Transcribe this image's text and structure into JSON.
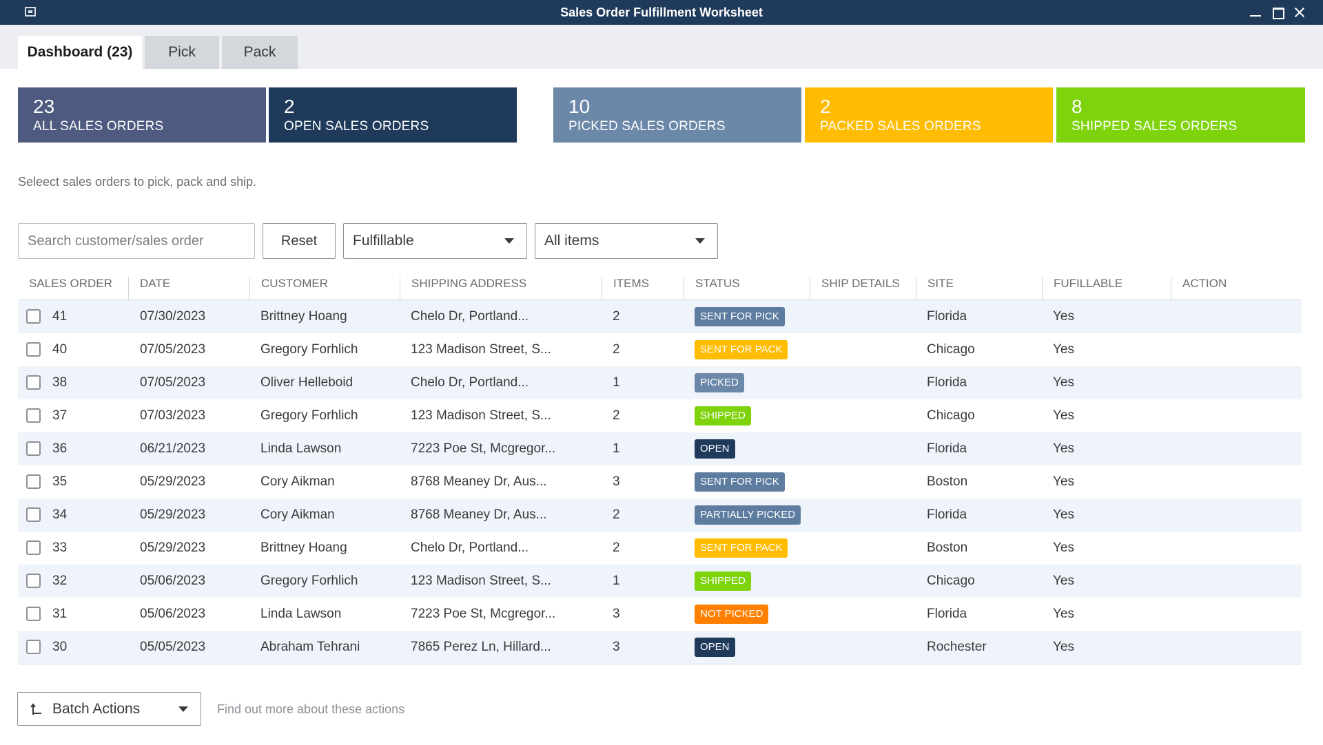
{
  "window": {
    "title": "Sales Order Fulfillment Worksheet"
  },
  "tabs": [
    {
      "label": "Dashboard (23)"
    },
    {
      "label": "Pick"
    },
    {
      "label": "Pack"
    }
  ],
  "cards": [
    {
      "count": "23",
      "label": "ALL SALES ORDERS",
      "color": "#4e5a7f"
    },
    {
      "count": "2",
      "label": "OPEN SALES ORDERS",
      "color": "#1f3a5a"
    },
    {
      "count": "10",
      "label": "PICKED SALES ORDERS",
      "color": "#6c88a8"
    },
    {
      "count": "2",
      "label": "PACKED SALES ORDERS",
      "color": "#ffbc00"
    },
    {
      "count": "8",
      "label": "SHIPPED SALES ORDERS",
      "color": "#7ed30d"
    }
  ],
  "hint": "Seleect sales orders to pick, pack and ship.",
  "filters": {
    "search_placeholder": "Search customer/sales order",
    "reset_label": "Reset",
    "fulfillable_value": "Fulfillable",
    "items_value": "All items"
  },
  "columns": [
    "SALES ORDER",
    "DATE",
    "CUSTOMER",
    "SHIPPING ADDRESS",
    "ITEMS",
    "STATUS",
    "SHIP DETAILS",
    "SITE",
    "FUFILLABLE",
    "ACTION"
  ],
  "status_colors": {
    "SENT FOR PICK": "#5d7c9f",
    "SENT FOR PACK": "#ffbc00",
    "PICKED": "#6c88a8",
    "SHIPPED": "#7ed30d",
    "OPEN": "#1f3a5a",
    "PARTIALLY PICKED": "#5d7c9f",
    "NOT PICKED": "#ff8000"
  },
  "rows": [
    {
      "order": "41",
      "date": "07/30/2023",
      "customer": "Brittney Hoang",
      "address": "Chelo Dr, Portland...",
      "items": "2",
      "status": "SENT FOR PICK",
      "ship": "",
      "site": "Florida",
      "fulfillable": "Yes",
      "action": ""
    },
    {
      "order": "40",
      "date": "07/05/2023",
      "customer": "Gregory Forhlich",
      "address": "123 Madison Street, S...",
      "items": "2",
      "status": "SENT FOR PACK",
      "ship": "",
      "site": "Chicago",
      "fulfillable": "Yes",
      "action": ""
    },
    {
      "order": "38",
      "date": "07/05/2023",
      "customer": "Oliver Helleboid",
      "address": "Chelo Dr, Portland...",
      "items": "1",
      "status": "PICKED",
      "ship": "",
      "site": "Florida",
      "fulfillable": "Yes",
      "action": ""
    },
    {
      "order": "37",
      "date": "07/03/2023",
      "customer": "Gregory Forhlich",
      "address": "123 Madison Street, S...",
      "items": "2",
      "status": "SHIPPED",
      "ship": "",
      "site": "Chicago",
      "fulfillable": "Yes",
      "action": ""
    },
    {
      "order": "36",
      "date": "06/21/2023",
      "customer": "Linda Lawson",
      "address": "7223 Poe St, Mcgregor...",
      "items": "1",
      "status": "OPEN",
      "ship": "",
      "site": "Florida",
      "fulfillable": "Yes",
      "action": ""
    },
    {
      "order": "35",
      "date": "05/29/2023",
      "customer": "Cory Aikman",
      "address": "8768 Meaney Dr, Aus...",
      "items": "3",
      "status": "SENT FOR PICK",
      "ship": "",
      "site": "Boston",
      "fulfillable": "Yes",
      "action": ""
    },
    {
      "order": "34",
      "date": "05/29/2023",
      "customer": "Cory Aikman",
      "address": "8768 Meaney Dr, Aus...",
      "items": "2",
      "status": "PARTIALLY PICKED",
      "ship": "",
      "site": "Florida",
      "fulfillable": "Yes",
      "action": ""
    },
    {
      "order": "33",
      "date": "05/29/2023",
      "customer": "Brittney Hoang",
      "address": "Chelo Dr, Portland...",
      "items": "2",
      "status": "SENT FOR PACK",
      "ship": "",
      "site": "Boston",
      "fulfillable": "Yes",
      "action": ""
    },
    {
      "order": "32",
      "date": "05/06/2023",
      "customer": "Gregory Forhlich",
      "address": "123 Madison Street, S...",
      "items": "1",
      "status": "SHIPPED",
      "ship": "",
      "site": "Chicago",
      "fulfillable": "Yes",
      "action": ""
    },
    {
      "order": "31",
      "date": "05/06/2023",
      "customer": "Linda Lawson",
      "address": "7223 Poe St, Mcgregor...",
      "items": "3",
      "status": "NOT PICKED",
      "ship": "",
      "site": "Florida",
      "fulfillable": "Yes",
      "action": ""
    },
    {
      "order": "30",
      "date": "05/05/2023",
      "customer": "Abraham Tehrani",
      "address": "7865 Perez Ln, Hillard...",
      "items": "3",
      "status": "OPEN",
      "ship": "",
      "site": "Rochester",
      "fulfillable": "Yes",
      "action": ""
    }
  ],
  "footer": {
    "batch_label": "Batch Actions",
    "more_link": "Find out more about these actions"
  }
}
